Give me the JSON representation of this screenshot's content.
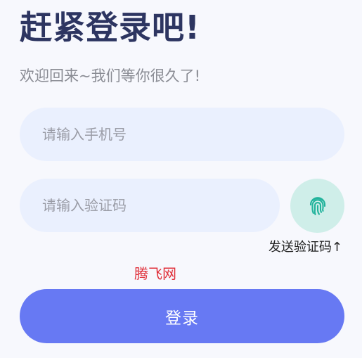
{
  "header": {
    "title": "赶紧登录吧!",
    "subtitle": "欢迎回来~我们等你很久了!"
  },
  "form": {
    "phone_placeholder": "请输入手机号",
    "phone_value": "",
    "code_placeholder": "请输入验证码",
    "code_value": "",
    "send_code_label": "发送验证码↑",
    "fingerprint_icon": "fingerprint-icon",
    "login_label": "登录"
  },
  "watermark": {
    "text": "腾飞网"
  },
  "colors": {
    "background": "#f7f8fd",
    "title": "#2d3561",
    "input_bg": "#eaf0fe",
    "fingerprint_bg": "#cfeee9",
    "fingerprint_icon": "#22b39c",
    "accent": "#6779f3",
    "watermark": "#e0303a"
  }
}
